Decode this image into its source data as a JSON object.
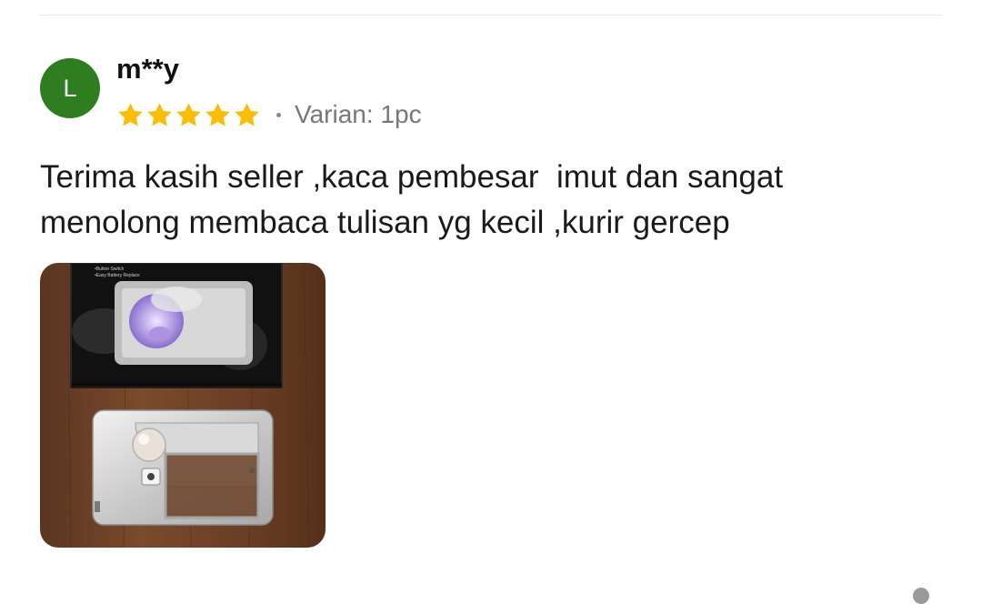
{
  "review": {
    "avatar_initial": "L",
    "username": "m**y",
    "rating": 5,
    "rating_max": 5,
    "variant": "Varian: 1pc",
    "text": "Terima kasih seller ,kaca pembesar  imut dan sangat\nmenolong membaca tulisan yg kecil ,kurir gercep",
    "photo_icon": "review-photo-thumbnail"
  },
  "colors": {
    "avatar_bg": "#2e7d1f",
    "star": "#fbbc04",
    "muted_text": "#777777"
  }
}
